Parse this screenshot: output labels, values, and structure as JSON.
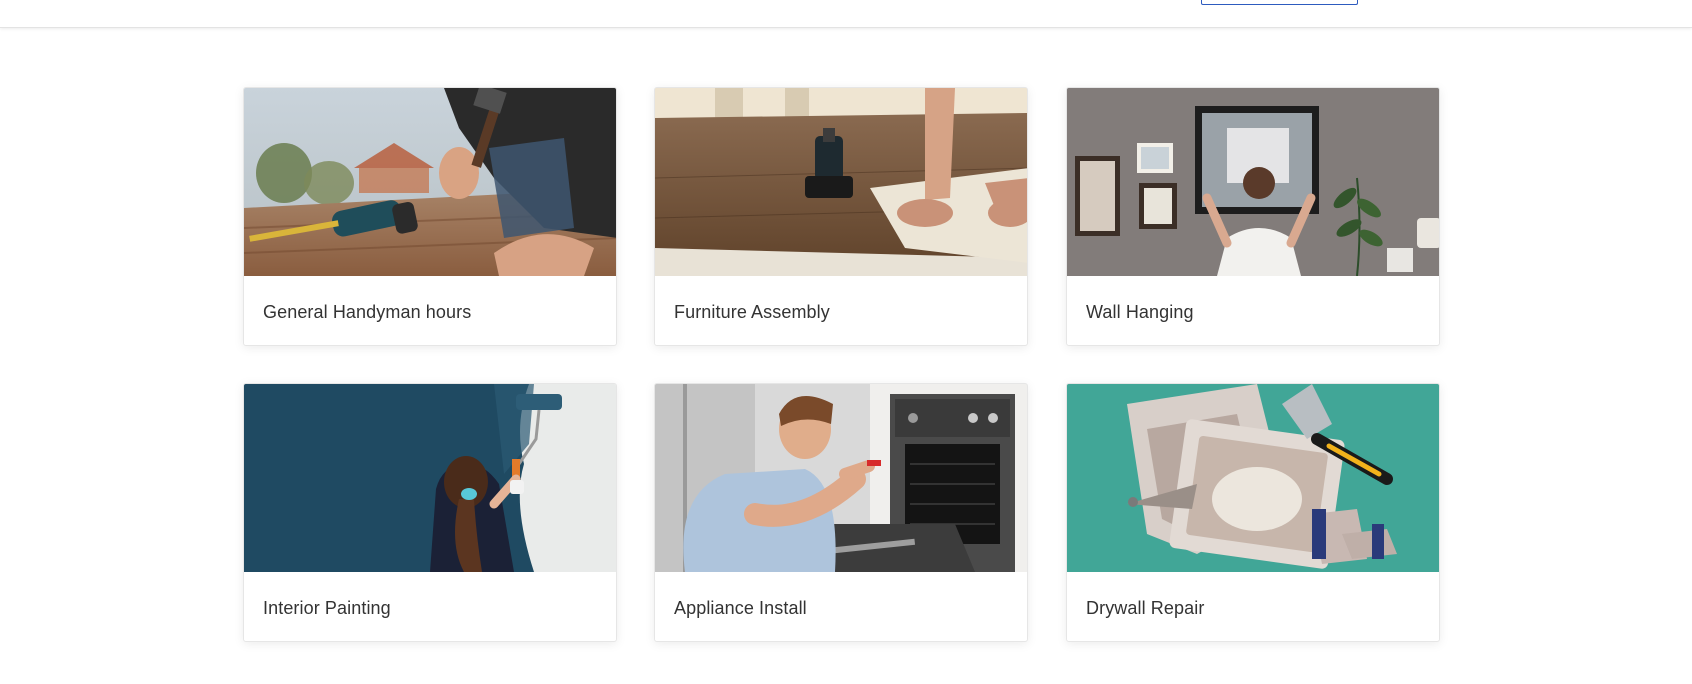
{
  "header": {
    "button_label": ""
  },
  "services": [
    {
      "title": "General Handyman hours"
    },
    {
      "title": "Furniture Assembly"
    },
    {
      "title": "Wall Hanging"
    },
    {
      "title": "Interior Painting"
    },
    {
      "title": "Appliance Install"
    },
    {
      "title": "Drywall Repair"
    }
  ]
}
